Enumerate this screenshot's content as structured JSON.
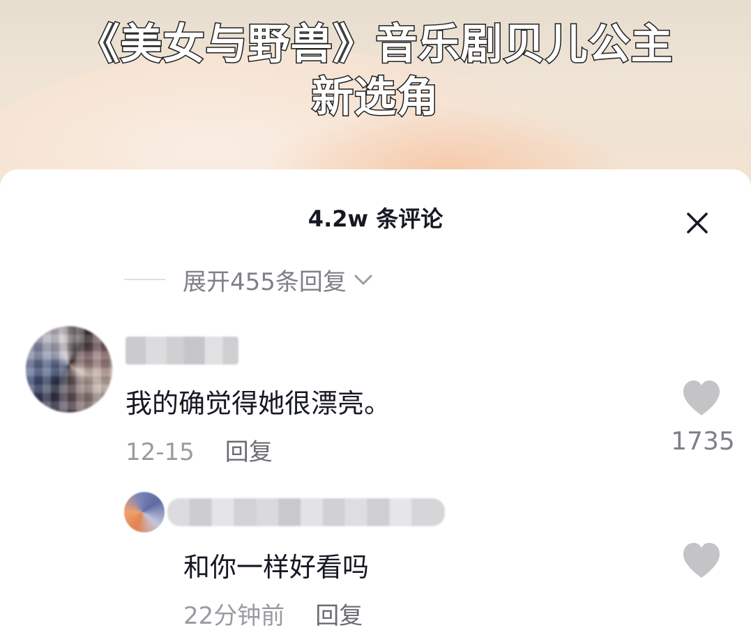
{
  "video": {
    "title_line1": "《美女与野兽》音乐剧贝儿公主",
    "title_line2": "新选角"
  },
  "comments_panel": {
    "count_label": "4.2w 条评论",
    "close_icon": "close-icon",
    "expand_replies": "展开455条回复",
    "expand_icon": "chevron-down-icon"
  },
  "comments": [
    {
      "text": "我的确觉得她很漂亮。",
      "date": "12-15",
      "reply_label": "回复",
      "like_icon": "heart-icon",
      "like_count": "1735"
    },
    {
      "text": "和你一样好看吗",
      "date": "22分钟前",
      "reply_label": "回复",
      "like_icon": "heart-icon"
    }
  ],
  "colors": {
    "primary_text": "#161823",
    "secondary_text": "#9a9ba1",
    "icon_gray": "#c4c4c6"
  }
}
